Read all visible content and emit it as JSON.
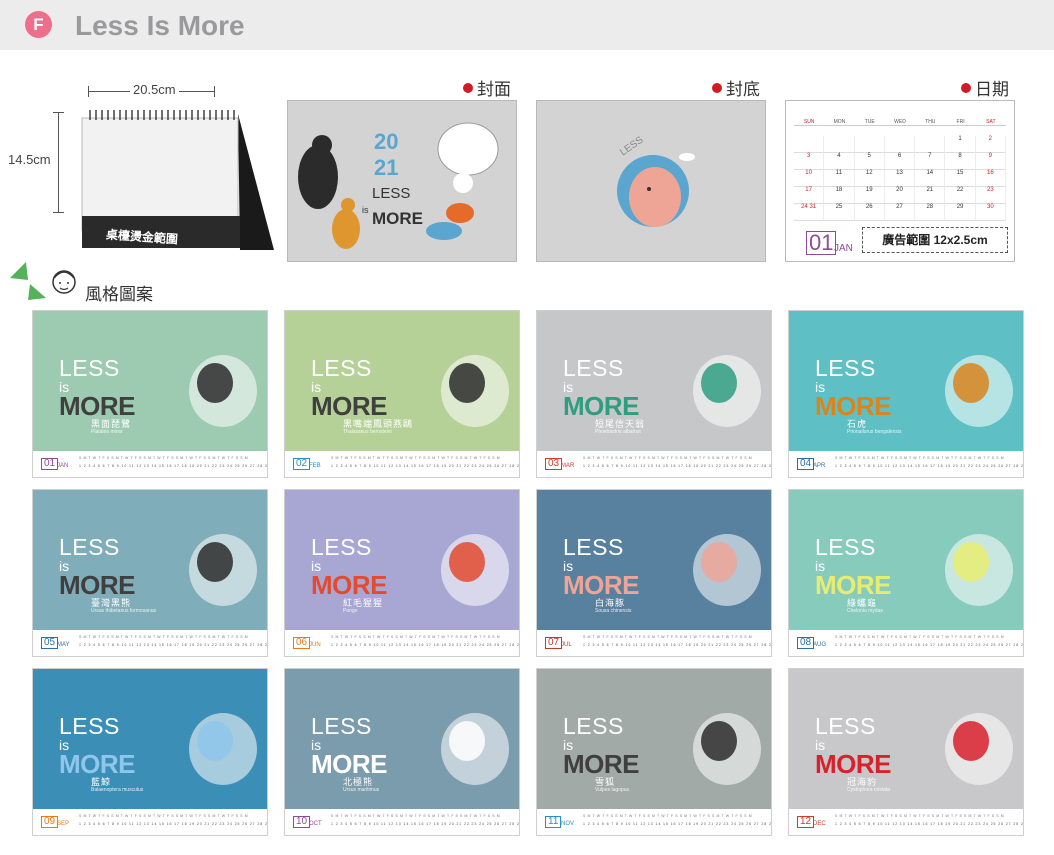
{
  "header": {
    "badge": "F",
    "title": "Less Is More",
    "brand_color": "#ee6f8c"
  },
  "desk_calendar": {
    "width_label": "20.5cm",
    "height_label": "14.5cm",
    "imprint_label": "桌檯燙金範圍"
  },
  "previews": {
    "cover_label": "封面",
    "back_label": "封底",
    "date_label": "日期"
  },
  "cover_art": {
    "year_top": "20",
    "year_bottom": "21",
    "less": "LESS",
    "is": "is",
    "more": "MORE"
  },
  "back_art": {
    "less": "LESS"
  },
  "date_page": {
    "weekdays": [
      "SUN",
      "MON",
      "TUE",
      "WED",
      "THU",
      "FRI",
      "SAT"
    ],
    "weeks": [
      [
        "",
        "",
        "",
        "",
        "",
        "1",
        "2"
      ],
      [
        "3",
        "4",
        "5",
        "6",
        "7",
        "8",
        "9"
      ],
      [
        "10",
        "11",
        "12",
        "13",
        "14",
        "15",
        "16"
      ],
      [
        "17",
        "18",
        "19",
        "20",
        "21",
        "22",
        "23"
      ],
      [
        "24 31",
        "25",
        "26",
        "27",
        "28",
        "29",
        "30"
      ]
    ],
    "month_num": "01",
    "month_abbr": "JAN",
    "ad_label": "廣告範圍 12x2.5cm"
  },
  "style_section": {
    "label": "風格圖案"
  },
  "template_text": {
    "less": "LESS",
    "is": "is",
    "more": "MORE",
    "days_row": "S M T W T F S S M T W T F S S M T W T F S S M T W T F S S M T W T F S S M",
    "nums_row": "1 2 3 4 5 6 7 8 9 10 11 12 13 14 15 16 17 18 19 20 21 22 23 24 25 26 27 28 29 30 31"
  },
  "months": [
    {
      "num": "01",
      "abbr": "JAN",
      "name_cn": "黑面琵鷺",
      "name_latin": "Platalea minor",
      "bg": "#9dcbb1",
      "more_color": "#3f3f3f",
      "accent": "#8e4b96"
    },
    {
      "num": "02",
      "abbr": "FEB",
      "name_cn": "黑嘴端鳳頭燕鷗",
      "name_latin": "Thalasseus bernsteini",
      "bg": "#b6d197",
      "more_color": "#3f3f3f",
      "accent": "#2b8fbf"
    },
    {
      "num": "03",
      "abbr": "MAR",
      "name_cn": "短尾信天翁",
      "name_latin": "Phoebastria albatrus",
      "bg": "#c6c7c8",
      "more_color": "#2f9d80",
      "accent": "#d33a2c"
    },
    {
      "num": "04",
      "abbr": "APR",
      "name_cn": "石虎",
      "name_latin": "Prionailurus bengalensis",
      "bg": "#5ec0c4",
      "more_color": "#d9851c",
      "accent": "#2b6fa8"
    },
    {
      "num": "05",
      "abbr": "MAY",
      "name_cn": "臺灣黑熊",
      "name_latin": "Ursus thibetanus formosanus",
      "bg": "#7fadb9",
      "more_color": "#3f3f3f",
      "accent": "#2b6fa8"
    },
    {
      "num": "06",
      "abbr": "JUN",
      "name_cn": "紅毛猩猩",
      "name_latin": "Pongo",
      "bg": "#a8a7d4",
      "more_color": "#e24b2f",
      "accent": "#e57b1f"
    },
    {
      "num": "07",
      "abbr": "JUL",
      "name_cn": "白海豚",
      "name_latin": "Sousa chinensis",
      "bg": "#58809f",
      "more_color": "#efa596",
      "accent": "#c0392b"
    },
    {
      "num": "08",
      "abbr": "AUG",
      "name_cn": "綠蠵龜",
      "name_latin": "Chelonia mydas",
      "bg": "#87cbbd",
      "more_color": "#e8ed70",
      "accent": "#2b6fa8"
    },
    {
      "num": "09",
      "abbr": "SEP",
      "name_cn": "藍鯨",
      "name_latin": "Balaenoptera musculus",
      "bg": "#3b8fb6",
      "more_color": "#8fc6ec",
      "accent": "#e57b1f"
    },
    {
      "num": "10",
      "abbr": "OCT",
      "name_cn": "北極熊",
      "name_latin": "Ursus maritimus",
      "bg": "#7b9cad",
      "more_color": "#ffffff",
      "accent": "#8e4b96"
    },
    {
      "num": "11",
      "abbr": "NOV",
      "name_cn": "雪狐",
      "name_latin": "Vulpes lagopus",
      "bg": "#a2aaa8",
      "more_color": "#3f3f3f",
      "accent": "#2b8fbf"
    },
    {
      "num": "12",
      "abbr": "DEC",
      "name_cn": "冠海豹",
      "name_latin": "Cystophora cristata",
      "bg": "#c8c8ca",
      "more_color": "#d9202d",
      "accent": "#d33a2c"
    }
  ]
}
